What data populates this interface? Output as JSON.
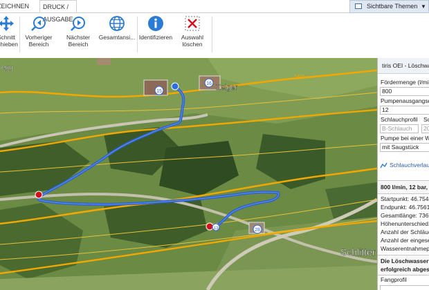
{
  "ribbon": {
    "tabs": [
      "ZEICHNEN",
      "DRUCK / AUSGABE"
    ],
    "themes_button": "Sichtbare Themen",
    "tools": [
      {
        "line1": "Schnitt",
        "line2": "schieben",
        "icon": "move-arrows-icon"
      },
      {
        "line1": "Vorheriger",
        "line2": "Bereich",
        "icon": "zoom-previous-icon"
      },
      {
        "line1": "Nächster",
        "line2": "Bereich",
        "icon": "zoom-next-icon"
      },
      {
        "line1": "Gesamtansi...",
        "line2": "",
        "icon": "globe-icon"
      },
      {
        "line1": "Identifizieren",
        "line2": "",
        "icon": "info-icon"
      },
      {
        "line1": "Auswahl",
        "line2": "löschen",
        "icon": "clear-selection-icon"
      }
    ]
  },
  "map": {
    "labels": {
      "place1": "Zelger",
      "place2": "Schlitter",
      "place_left": "egg",
      "contour": "1400"
    },
    "markers": {
      "house1": "15",
      "house2": "16",
      "house3": "28",
      "house4": "13"
    }
  },
  "panel": {
    "title": "tiris OEI - Löschwa",
    "foerdermenge_label": "Fördermenge (l/min",
    "foerdermenge_value": "800",
    "pumpendruck_label": "Pumpenausgangsdr",
    "pumpendruck_value": "12",
    "schlauchprofil_label": "Schlauchprofil",
    "schlauchprofil_label2": "Sc",
    "schlauchprofil_value": "B-Schlauch",
    "schlauch_extra": "20",
    "pumpe_label": "Pumpe bei einer Wa",
    "pumpe_value": "mit Saugstück",
    "verlauf_link": "Schlauchverlauf",
    "result_title": "800 l/min, 12 bar,",
    "startpunkt": "Startpunkt: 46.7545",
    "endpunkt": "Endpunkt: 46.7561",
    "gesamtlaenge": "Gesamtlänge: 736 m",
    "hoehenunterschied": "Höhenunterschied:",
    "anzahl_schlaeuche": "Anzahl der Schläuc",
    "anzahl_eingesetzt": "Anzahl der eingese",
    "wasserentnahme": "Wasserentnahmepu",
    "status_line1": "Die Löschwasserfö",
    "status_line2": "erfolgreich abgesc",
    "fangprofil_label": "Fangprofil"
  },
  "colors": {
    "route": "#2e5fd6",
    "start_marker": "#d0121c",
    "contour_major": "#f0a800",
    "contour_minor": "#e8c23a",
    "info": "#2a7bd3"
  }
}
